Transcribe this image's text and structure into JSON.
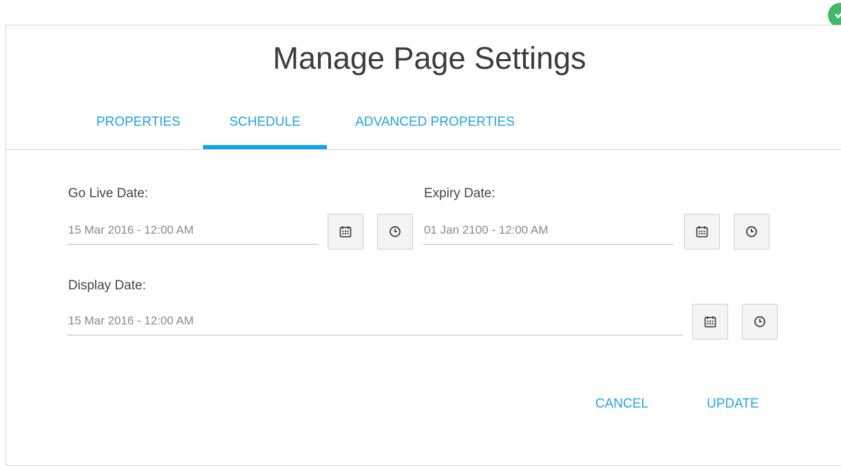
{
  "dialog": {
    "title": "Manage Page Settings"
  },
  "tabs": [
    {
      "label": "PROPERTIES",
      "active": false
    },
    {
      "label": "SCHEDULE",
      "active": true
    },
    {
      "label": "ADVANCED PROPERTIES",
      "active": false
    }
  ],
  "schedule": {
    "go_live": {
      "label": "Go Live Date:",
      "value": "15 Mar 2016 - 12:00 AM"
    },
    "expiry": {
      "label": "Expiry Date:",
      "value": "01 Jan 2100 - 12:00 AM"
    },
    "display": {
      "label": "Display Date:",
      "value": "15 Mar 2016 - 12:00 AM"
    }
  },
  "actions": {
    "cancel_label": "CANCEL",
    "update_label": "UPDATE"
  },
  "icons": {
    "date_picker": "calendar-icon",
    "time_picker": "clock-icon",
    "status": "checkmark-icon"
  },
  "colors": {
    "accent": "#10a4ea",
    "status": "#3fb96a",
    "title": "#3c3c3c"
  }
}
